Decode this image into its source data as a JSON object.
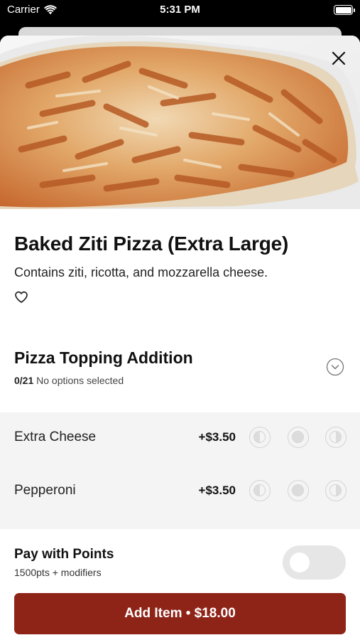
{
  "status_bar": {
    "carrier": "Carrier",
    "time": "5:31 PM"
  },
  "item": {
    "title": "Baked Ziti Pizza (Extra Large)",
    "description": "Contains ziti, ricotta, and mozzarella cheese.",
    "favorited": false
  },
  "modifier_group": {
    "title": "Pizza Topping Addition",
    "count": "0/21",
    "status": "No options selected"
  },
  "options": [
    {
      "name": "Extra Cheese",
      "price": "+$3.50"
    },
    {
      "name": "Pepperoni",
      "price": "+$3.50"
    }
  ],
  "points": {
    "title": "Pay with Points",
    "subtitle": "1500pts + modifiers",
    "enabled": false
  },
  "add_button": {
    "label": "Add Item • $18.00"
  },
  "colors": {
    "primary": "#8e2318",
    "toggle_off": "#e6e6e6",
    "options_bg": "#f4f4f4"
  },
  "icons": {
    "wifi": "wifi-icon",
    "battery": "battery-icon",
    "close": "close-icon",
    "favorite": "heart-icon",
    "expand": "chevron-down-icon",
    "placement": [
      "left-half-icon",
      "whole-icon",
      "right-half-icon"
    ]
  }
}
